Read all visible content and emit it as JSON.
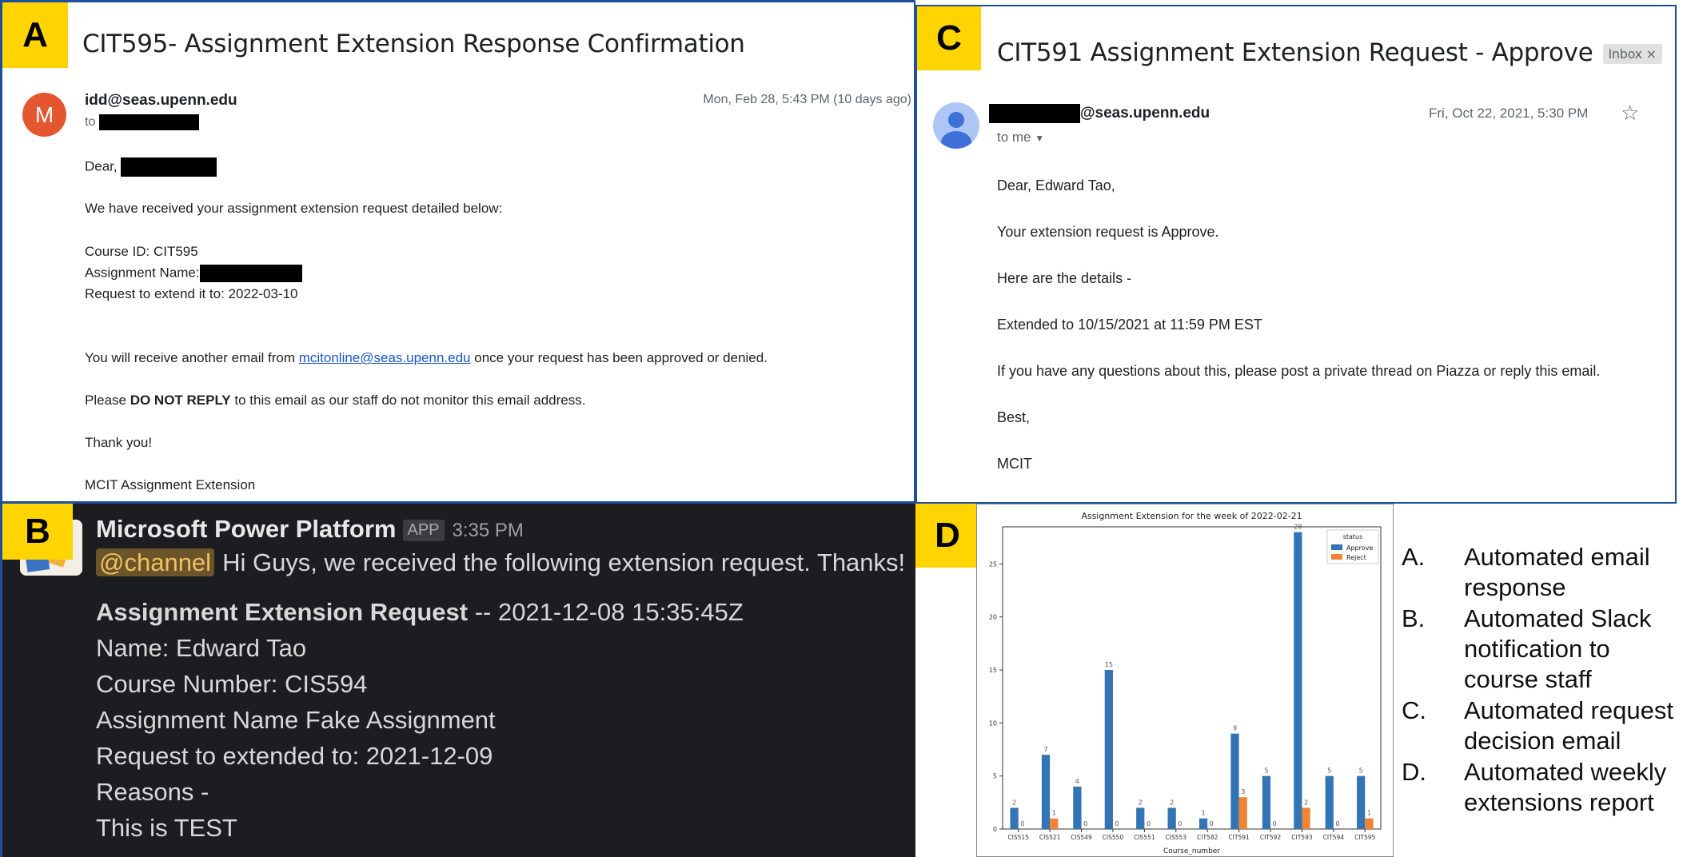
{
  "panel_a": {
    "tag": "A",
    "subject": "CIT595- Assignment Extension Response Confirmation",
    "avatar_letter": "M",
    "sender": "idd@seas.upenn.edu",
    "to_prefix": "to",
    "date": "Mon, Feb 28, 5:43 PM (10 days ago)",
    "greeting": "Dear,",
    "line_received": "We have received your assignment extension request detailed below:",
    "course_id": "Course ID: CIT595",
    "assignment_name": "Assignment Name:",
    "request_extend": "Request to extend it to: 2022-03-10",
    "another_email_before": "You will receive another email from ",
    "another_email_link": "mcitonline@seas.upenn.edu",
    "another_email_after": " once your request has been approved or denied.",
    "please_before": "Please ",
    "please_bold": "DO NOT REPLY",
    "please_after": " to this email as our staff do not monitor this email address.",
    "thanks": "Thank you!",
    "signature": "MCIT Assignment Extension"
  },
  "panel_c": {
    "tag": "C",
    "subject": "CIT591 Assignment Extension Request - Approve",
    "inbox_label": "Inbox ×",
    "sender_domain": "@seas.upenn.edu",
    "to_me": "to me",
    "date": "Fri, Oct 22, 2021, 5:30 PM",
    "greeting": "Dear, Edward Tao,",
    "status_line": "Your extension request is Approve.",
    "details_intro": "Here are the details -",
    "extended_to": "Extended to 10/15/2021 at 11:59 PM EST",
    "questions": "If you have any questions about this, please post a private thread on Piazza or reply this email.",
    "closing": "Best,",
    "signature": "MCIT"
  },
  "panel_b": {
    "tag": "B",
    "app_name": "Microsoft Power Platform",
    "app_badge": "APP",
    "time": "3:35 PM",
    "mention": "@channel",
    "message": "Hi Guys, we received the following extension request. Thanks!",
    "request_title": "Assignment Extension Request",
    "request_timestamp": " -- 2021-12-08 15:35:45Z",
    "name_line": "Name: Edward Tao",
    "course_line": "Course Number: CIS594",
    "assignment_line": "Assignment Name Fake Assignment",
    "extend_line": "Request to extended to: 2021-12-09",
    "reasons_line": "Reasons -",
    "test_line": "This is TEST"
  },
  "panel_d": {
    "tag": "D",
    "legend_list": [
      {
        "letter": "A.",
        "text": "Automated email response"
      },
      {
        "letter": "B.",
        "text": "Automated Slack notification to course staff"
      },
      {
        "letter": "C.",
        "text": "Automated request decision email"
      },
      {
        "letter": "D.",
        "text": "Automated weekly extensions report"
      }
    ]
  },
  "colors": {
    "approve": "#3274b4",
    "reject": "#ee8434",
    "tag_yellow": "#ffd400",
    "border_blue": "#1e4f9c",
    "slack_bg": "#1b1d21"
  },
  "chart_data": {
    "type": "bar",
    "title": "Assignment Extension for the week of 2022-02-21",
    "xlabel": "Course_number",
    "ylabel": "",
    "ylim": [
      0,
      28.5
    ],
    "yticks": [
      0,
      5,
      10,
      15,
      20,
      25
    ],
    "legend_title": "status",
    "legend_position": "top-right",
    "categories": [
      "CIS515",
      "CIS521",
      "CIS549",
      "CIS550",
      "CIS551",
      "CIS553",
      "CIT582",
      "CIT591",
      "CIT592",
      "CIT593",
      "CIT594",
      "CIT595"
    ],
    "series": [
      {
        "name": "Approve",
        "values": [
          2,
          7,
          4,
          15,
          2,
          2,
          1,
          9,
          5,
          28,
          5,
          5
        ]
      },
      {
        "name": "Reject",
        "values": [
          0,
          1,
          0,
          0,
          0,
          0,
          0,
          3,
          0,
          2,
          0,
          1
        ]
      }
    ]
  }
}
